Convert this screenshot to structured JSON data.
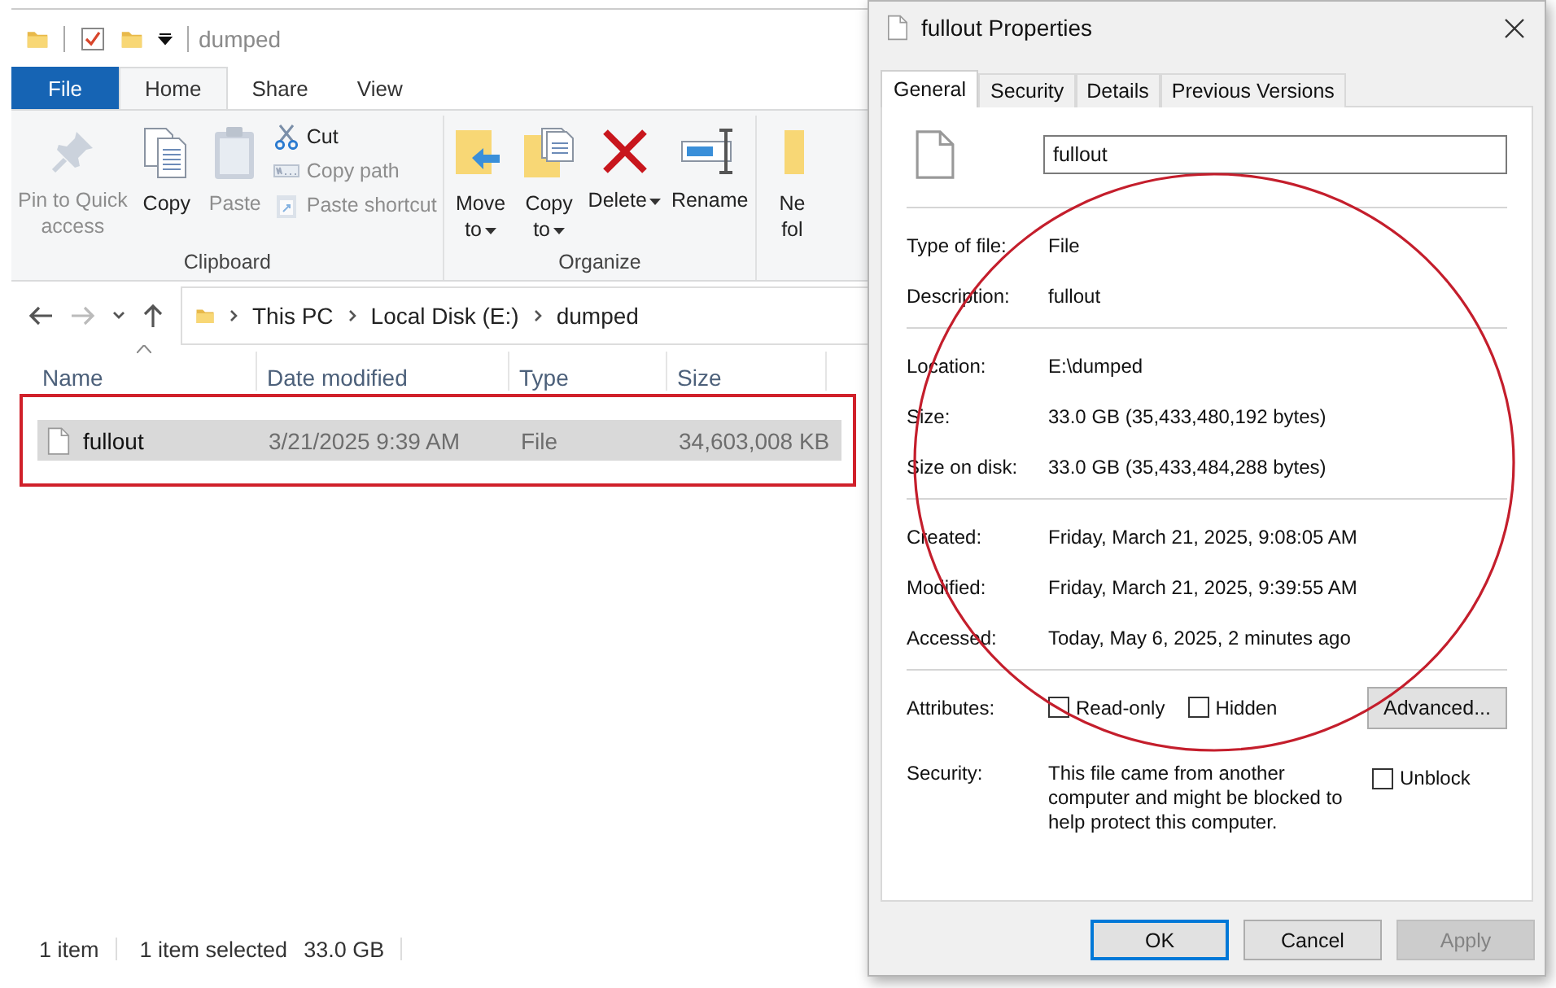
{
  "explorer": {
    "title": "dumped",
    "tabs": [
      {
        "label": "File",
        "kind": "file",
        "selected": false
      },
      {
        "label": "Home",
        "kind": "tab",
        "selected": true
      },
      {
        "label": "Share",
        "kind": "tab",
        "selected": false
      },
      {
        "label": "View",
        "kind": "tab",
        "selected": false
      }
    ],
    "ribbon_groups": [
      {
        "label": "Clipboard",
        "items": [
          {
            "kind": "large",
            "label": "Pin to Quick\naccess",
            "disabled": true,
            "dropdown": false
          },
          {
            "kind": "large",
            "label": "Copy",
            "disabled": false,
            "dropdown": false
          },
          {
            "kind": "large",
            "label": "Paste",
            "disabled": true,
            "dropdown": false
          },
          {
            "kind": "small",
            "label": "Cut",
            "disabled": false,
            "dropdown": false
          },
          {
            "kind": "small",
            "label": "Copy path",
            "disabled": true,
            "dropdown": false
          },
          {
            "kind": "small",
            "label": "Paste shortcut",
            "disabled": true,
            "dropdown": false
          }
        ]
      },
      {
        "label": "Organize",
        "items": [
          {
            "kind": "large",
            "label": "Move\nto",
            "disabled": false,
            "dropdown": true
          },
          {
            "kind": "large",
            "label": "Copy\nto",
            "disabled": false,
            "dropdown": true
          },
          {
            "kind": "large",
            "label": "Delete",
            "disabled": false,
            "dropdown": true
          },
          {
            "kind": "large",
            "label": "Rename",
            "disabled": false,
            "dropdown": false
          }
        ]
      },
      {
        "items": [
          {
            "kind": "large",
            "label": "Ne\nfol",
            "disabled": false,
            "dropdown": false
          }
        ]
      }
    ],
    "breadcrumb": [
      "This PC",
      "Local Disk (E:)",
      "dumped"
    ],
    "columns": [
      {
        "label": "Name",
        "sorted": true
      },
      {
        "label": "Date modified",
        "sorted": false
      },
      {
        "label": "Type",
        "sorted": false
      },
      {
        "label": "Size",
        "sorted": false
      }
    ],
    "rows": [
      {
        "cells": [
          "fullout",
          "3/21/2025 9:39 AM",
          "File",
          "34,603,008 KB"
        ],
        "selected": true
      }
    ],
    "status_bar": [
      "1 item",
      "1 item selected",
      "33.0 GB"
    ]
  },
  "properties": {
    "title": "fullout Properties",
    "tabs": [
      {
        "label": "General",
        "selected": true
      },
      {
        "label": "Security",
        "selected": false
      },
      {
        "label": "Details",
        "selected": false
      },
      {
        "label": "Previous Versions",
        "selected": false
      }
    ],
    "name_field": {
      "value": "fullout"
    },
    "sections": [
      [
        {
          "label": "Type of file:",
          "value": "File"
        },
        {
          "label": "Description:",
          "value": "fullout"
        }
      ],
      [
        {
          "label": "Location:",
          "value": "E:\\dumped"
        },
        {
          "label": "Size:",
          "value": "33.0 GB (35,433,480,192 bytes)"
        },
        {
          "label": "Size on disk:",
          "value": "33.0 GB (35,433,484,288 bytes)"
        }
      ],
      [
        {
          "label": "Created:",
          "value": "Friday, March 21, 2025, 9:08:05 AM"
        },
        {
          "label": "Modified:",
          "value": "Friday, March 21, 2025, 9:39:55 AM"
        },
        {
          "label": "Accessed:",
          "value": "Today, May 6, 2025, 2 minutes ago"
        }
      ]
    ],
    "attributes": {
      "label": "Attributes:",
      "checkboxes": [
        {
          "label": "Read-only",
          "checked": false
        },
        {
          "label": "Hidden",
          "checked": false
        }
      ],
      "button": "Advanced..."
    },
    "security": {
      "label": "Security:",
      "text": "This file came from another computer and might be blocked to help protect this computer.",
      "checkbox": {
        "label": "Unblock",
        "checked": false
      }
    },
    "buttons": [
      {
        "label": "OK",
        "kind": "default",
        "disabled": false
      },
      {
        "label": "Cancel",
        "kind": "normal",
        "disabled": false
      },
      {
        "label": "Apply",
        "kind": "normal",
        "disabled": true
      }
    ]
  }
}
